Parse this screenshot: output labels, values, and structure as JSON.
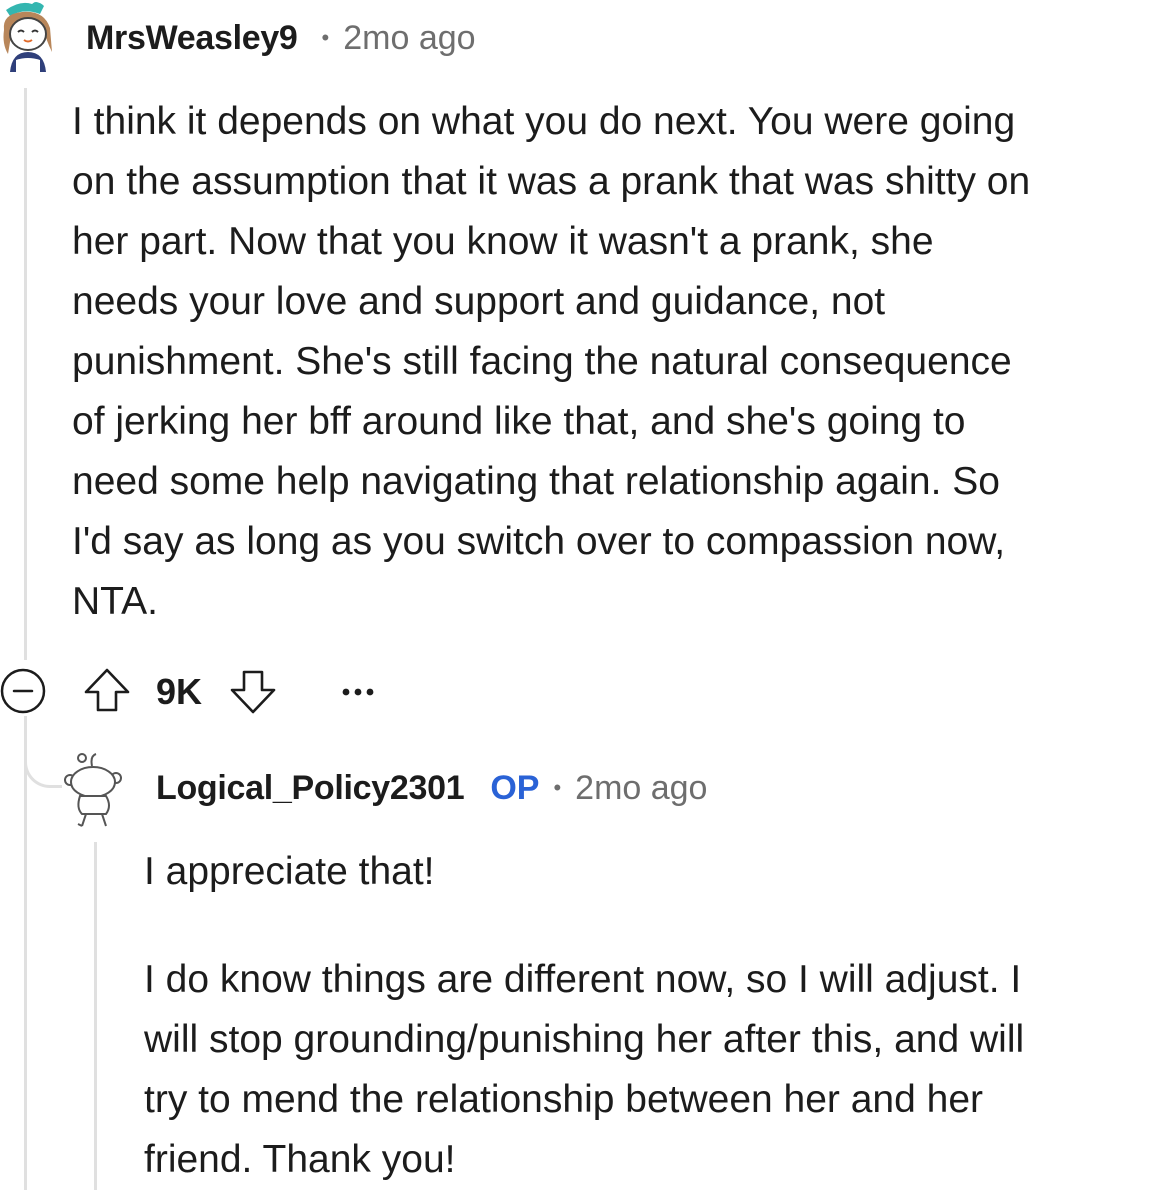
{
  "comment": {
    "username": "MrsWeasley9",
    "separator": "•",
    "timestamp": "2mo ago",
    "avatar_icon": "snoo-avatar-icon",
    "body": "I think it depends on what you do next. You were going\non the assumption that it was a prank that was shitty on\nher part. Now that you know it wasn't a prank, she\nneeds your love and support and guidance, not\npunishment. She's still facing the natural consequence\nof jerking her bff around like that, and she's going to\nneed some help navigating that relationship again. So\nI'd say as long as you switch over to compassion now,\nNTA.",
    "actions": {
      "collapse_icon": "collapse-minus-icon",
      "upvote_icon": "arrow-up-icon",
      "vote_count": "9K",
      "downvote_icon": "arrow-down-icon",
      "more_icon": "ellipsis-icon"
    }
  },
  "reply": {
    "username": "Logical_Policy2301",
    "badge": "OP",
    "separator": "•",
    "timestamp": "2mo ago",
    "avatar_icon": "default-snoo-avatar-icon",
    "paragraphs": [
      "I appreciate that!",
      "I do know things are different now, so I will adjust. I\nwill stop grounding/punishing her after this, and will\ntry to mend the relationship between her and her\nfriend. Thank you!"
    ]
  },
  "colors": {
    "text": "#1c1c1c",
    "muted": "#6e6e6e",
    "op_badge": "#2a62d6",
    "thread_line": "#e0e0e0"
  }
}
